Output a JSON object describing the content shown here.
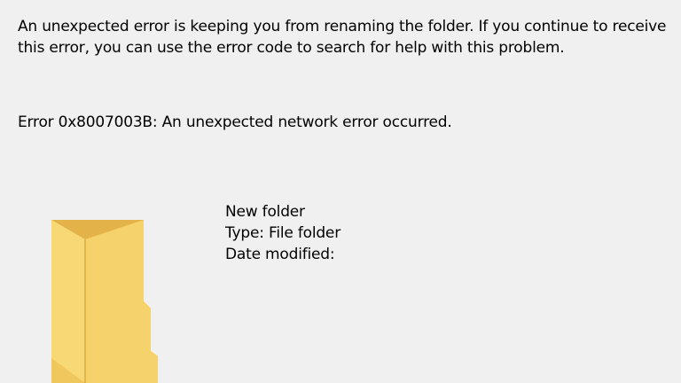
{
  "dialog": {
    "message": "An unexpected error is keeping you from renaming the folder. If you continue to receive this error, you can use the error code to search for help with this problem.",
    "error_line": "Error 0x8007003B: An unexpected network error occurred."
  },
  "item": {
    "icon": "folder-icon",
    "name": "New folder",
    "type": "Type: File folder",
    "date_modified": "Date modified:"
  },
  "colors": {
    "background": "#f0f0f0",
    "folder_front": "#f8d775",
    "folder_back": "#e3b34a"
  }
}
